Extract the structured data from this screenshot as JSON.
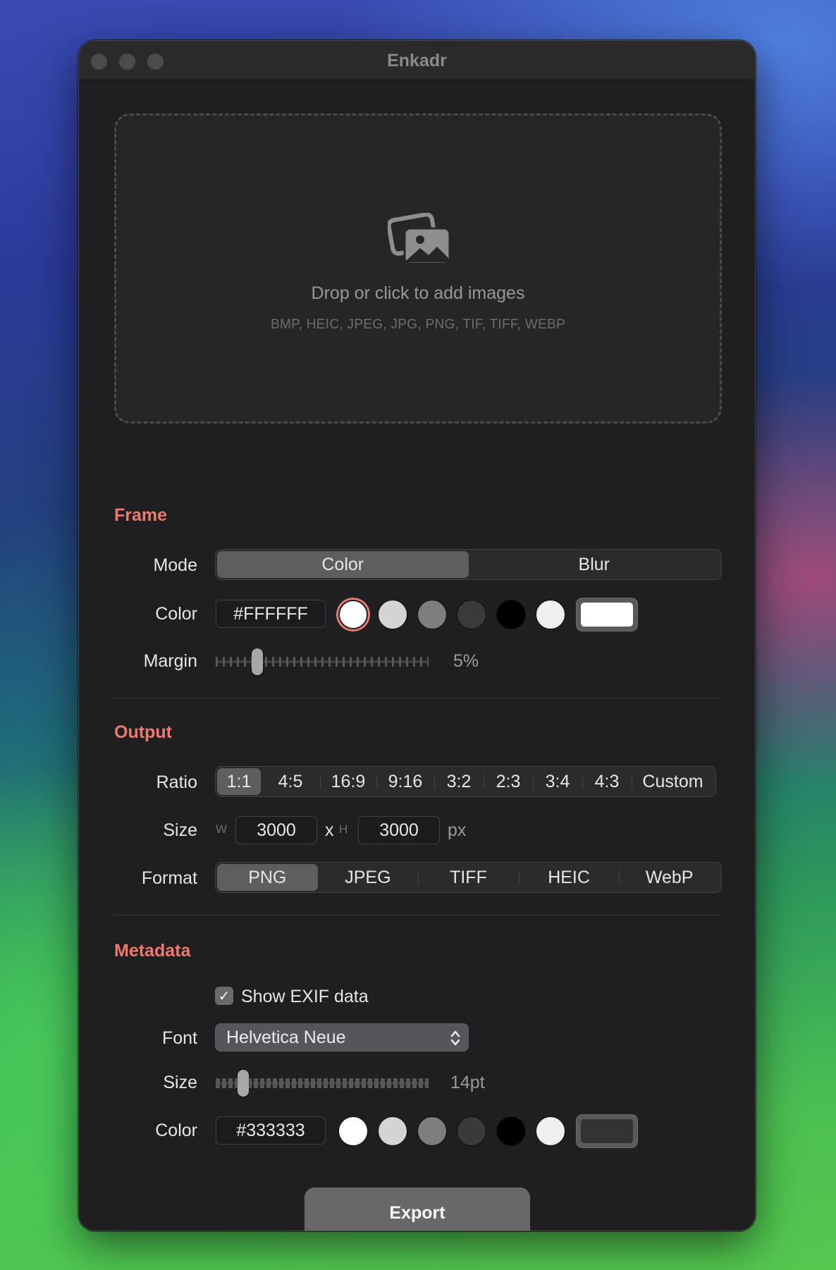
{
  "window": {
    "title": "Enkadr"
  },
  "drop_zone": {
    "title": "Drop or click to add images",
    "formats": "BMP, HEIC, JPEG, JPG, PNG, TIF, TIFF, WEBP",
    "icon": "photos-icon"
  },
  "frame": {
    "section_title": "Frame",
    "mode_label": "Mode",
    "mode_options": [
      "Color",
      "Blur"
    ],
    "mode_selected": "Color",
    "color_label": "Color",
    "color_value": "#FFFFFF",
    "swatches": [
      "#FFFFFF",
      "#D4D4D6",
      "#7E7E81",
      "#3A3A3C",
      "#000000",
      "#EFEFF1"
    ],
    "swatch_selected": "#FFFFFF",
    "well_color": "#FFFFFF",
    "margin_label": "Margin",
    "margin_value": "5%",
    "margin_fraction": 0.18
  },
  "output": {
    "section_title": "Output",
    "ratio_label": "Ratio",
    "ratio_options": [
      "1:1",
      "4:5",
      "16:9",
      "9:16",
      "3:2",
      "2:3",
      "3:4",
      "4:3",
      "Custom"
    ],
    "ratio_selected": "1:1",
    "size_label": "Size",
    "w_label": "W",
    "h_label": "H",
    "width": "3000",
    "x_sep": "x",
    "height": "3000",
    "unit": "px",
    "format_label": "Format",
    "format_options": [
      "PNG",
      "JPEG",
      "TIFF",
      "HEIC",
      "WebP"
    ],
    "format_selected": "PNG"
  },
  "metadata": {
    "section_title": "Metadata",
    "show_exif_label": "Show EXIF data",
    "show_exif_checked": true,
    "font_label": "Font",
    "font_value": "Helvetica Neue",
    "size_label": "Size",
    "size_value": "14pt",
    "size_fraction": 0.11,
    "color_label": "Color",
    "color_value": "#333333",
    "swatches": [
      "#FFFFFF",
      "#D4D4D6",
      "#7E7E81",
      "#3A3A3C",
      "#000000",
      "#EFEFF1"
    ],
    "well_color": "#333333"
  },
  "export": {
    "label": "Export"
  }
}
